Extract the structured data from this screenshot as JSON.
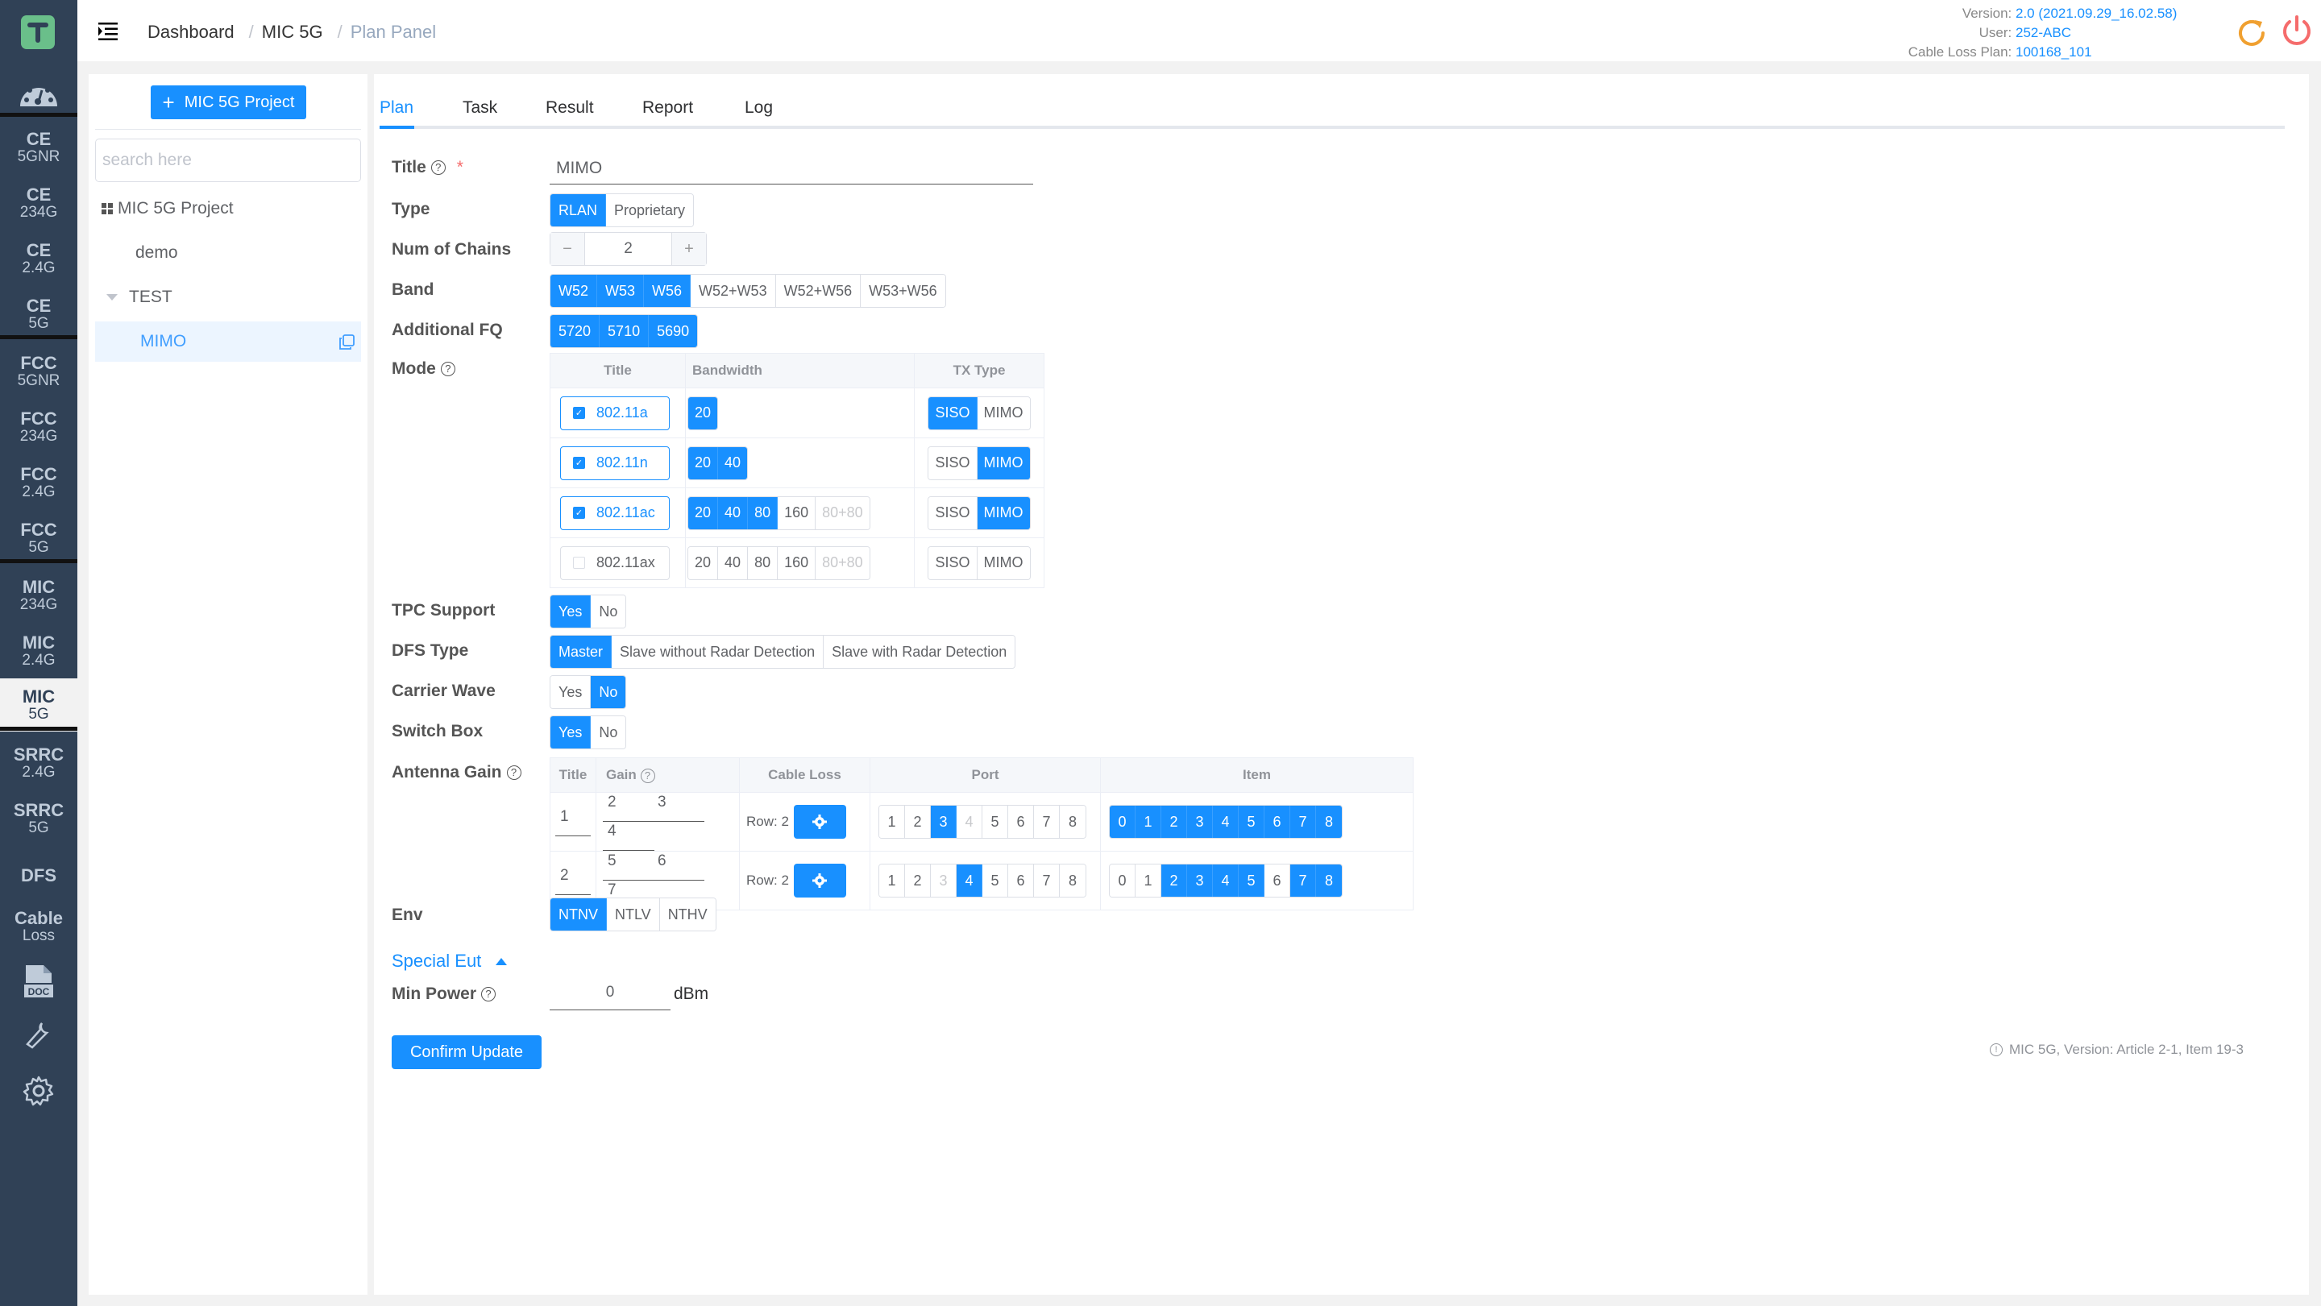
{
  "sidebar": {
    "logo": "T",
    "items": [
      {
        "l1": "CE",
        "l2": "5GNR"
      },
      {
        "l1": "CE",
        "l2": "234G"
      },
      {
        "l1": "CE",
        "l2": "2.4G"
      },
      {
        "l1": "CE",
        "l2": "5G"
      },
      {
        "l1": "FCC",
        "l2": "5GNR"
      },
      {
        "l1": "FCC",
        "l2": "234G"
      },
      {
        "l1": "FCC",
        "l2": "2.4G"
      },
      {
        "l1": "FCC",
        "l2": "5G"
      },
      {
        "l1": "MIC",
        "l2": "234G"
      },
      {
        "l1": "MIC",
        "l2": "2.4G"
      },
      {
        "l1": "MIC",
        "l2": "5G",
        "active": true
      },
      {
        "l1": "SRRC",
        "l2": "2.4G"
      },
      {
        "l1": "SRRC",
        "l2": "5G"
      },
      {
        "l1": "DFS",
        "l2": ""
      },
      {
        "l1": "Cable",
        "l2": "Loss"
      }
    ],
    "doc_label": "DOC"
  },
  "header": {
    "breadcrumb": [
      "Dashboard",
      "MIC 5G",
      "Plan Panel"
    ],
    "info": [
      {
        "label": "Version:",
        "value": "2.0 (2021.09.29_16.02.58)"
      },
      {
        "label": "User:",
        "value": "252-ABC"
      },
      {
        "label": "Cable Loss Plan:",
        "value": "100168_101"
      }
    ],
    "refresh_color": "#f0a030",
    "power_color": "#f56c6c"
  },
  "left_panel": {
    "add_button": "MIC 5G Project",
    "search_placeholder": "search here",
    "tree": [
      {
        "label": "MIC 5G Project",
        "level": 0,
        "icon": "grid"
      },
      {
        "label": "demo",
        "level": 1
      },
      {
        "label": "TEST",
        "level": 1,
        "expanded": true
      },
      {
        "label": "MIMO",
        "level": 2,
        "selected": true
      }
    ]
  },
  "tabs": [
    "Plan",
    "Task",
    "Result",
    "Report",
    "Log"
  ],
  "active_tab": "Plan",
  "form": {
    "title": {
      "label": "Title",
      "value": "MIMO",
      "required": "*"
    },
    "type": {
      "label": "Type",
      "options": [
        "RLAN",
        "Proprietary"
      ],
      "selected": [
        "RLAN"
      ]
    },
    "chains": {
      "label": "Num of Chains",
      "value": "2",
      "minus": "−",
      "plus": "+"
    },
    "band": {
      "label": "Band",
      "options": [
        "W52",
        "W53",
        "W56",
        "W52+W53",
        "W52+W56",
        "W53+W56"
      ],
      "selected": [
        "W52",
        "W53",
        "W56"
      ]
    },
    "additional_fq": {
      "label": "Additional FQ",
      "options": [
        "5720",
        "5710",
        "5690"
      ],
      "selected": [
        "5720",
        "5710",
        "5690"
      ]
    },
    "mode": {
      "label": "Mode",
      "headers": [
        "Title",
        "Bandwidth",
        "TX Type"
      ],
      "rows": [
        {
          "title": "802.11a",
          "checked": true,
          "bandwidth": [
            "20"
          ],
          "bw_selected": [
            "20"
          ],
          "bw_disabled": [],
          "tx": [
            "SISO",
            "MIMO"
          ],
          "tx_selected": "SISO"
        },
        {
          "title": "802.11n",
          "checked": true,
          "bandwidth": [
            "20",
            "40"
          ],
          "bw_selected": [
            "20",
            "40"
          ],
          "bw_disabled": [],
          "tx": [
            "SISO",
            "MIMO"
          ],
          "tx_selected": "MIMO"
        },
        {
          "title": "802.11ac",
          "checked": true,
          "bandwidth": [
            "20",
            "40",
            "80",
            "160",
            "80+80"
          ],
          "bw_selected": [
            "20",
            "40",
            "80"
          ],
          "bw_disabled": [
            "80+80"
          ],
          "tx": [
            "SISO",
            "MIMO"
          ],
          "tx_selected": "MIMO"
        },
        {
          "title": "802.11ax",
          "checked": false,
          "bandwidth": [
            "20",
            "40",
            "80",
            "160",
            "80+80"
          ],
          "bw_selected": [],
          "bw_disabled": [
            "80+80"
          ],
          "tx": [
            "SISO",
            "MIMO"
          ],
          "tx_selected": ""
        }
      ]
    },
    "tpc": {
      "label": "TPC Support",
      "options": [
        "Yes",
        "No"
      ],
      "selected": [
        "Yes"
      ]
    },
    "dfs": {
      "label": "DFS Type",
      "options": [
        "Master",
        "Slave without Radar Detection",
        "Slave with Radar Detection"
      ],
      "selected": [
        "Master"
      ]
    },
    "carrier": {
      "label": "Carrier Wave",
      "options": [
        "Yes",
        "No"
      ],
      "selected": [
        "No"
      ]
    },
    "switchbox": {
      "label": "Switch Box",
      "options": [
        "Yes",
        "No"
      ],
      "selected": [
        "Yes"
      ]
    },
    "antenna": {
      "label": "Antenna Gain",
      "headers": [
        "Title",
        "Gain",
        "Cable Loss",
        "Port",
        "Item"
      ],
      "rows": [
        {
          "title": "1",
          "gains": [
            "2",
            "3",
            "4"
          ],
          "cable_loss": "Row: 2",
          "ports": [
            "1",
            "2",
            "3",
            "4",
            "5",
            "6",
            "7",
            "8"
          ],
          "port_selected": [
            "3"
          ],
          "port_disabled": [
            "4"
          ],
          "items": [
            "0",
            "1",
            "2",
            "3",
            "4",
            "5",
            "6",
            "7",
            "8"
          ],
          "item_selected": [
            "0",
            "1",
            "2",
            "3",
            "4",
            "5",
            "6",
            "7",
            "8"
          ]
        },
        {
          "title": "2",
          "gains": [
            "5",
            "6",
            "7"
          ],
          "cable_loss": "Row: 2",
          "ports": [
            "1",
            "2",
            "3",
            "4",
            "5",
            "6",
            "7",
            "8"
          ],
          "port_selected": [
            "4"
          ],
          "port_disabled": [
            "3"
          ],
          "items": [
            "0",
            "1",
            "2",
            "3",
            "4",
            "5",
            "6",
            "7",
            "8"
          ],
          "item_selected": [
            "2",
            "3",
            "4",
            "5",
            "7",
            "8"
          ]
        }
      ]
    },
    "env": {
      "label": "Env",
      "options": [
        "NTNV",
        "NTLV",
        "NTHV"
      ],
      "selected": [
        "NTNV"
      ]
    },
    "special_eut": "Special Eut",
    "min_power": {
      "label": "Min Power",
      "value": "0",
      "unit": "dBm"
    },
    "confirm": "Confirm Update",
    "note": "MIC 5G, Version: Article 2-1, Item 19-3"
  },
  "colors": {
    "primary": "#1890ff",
    "sidebar_bg": "#304156",
    "logo": "#6abf8a"
  }
}
